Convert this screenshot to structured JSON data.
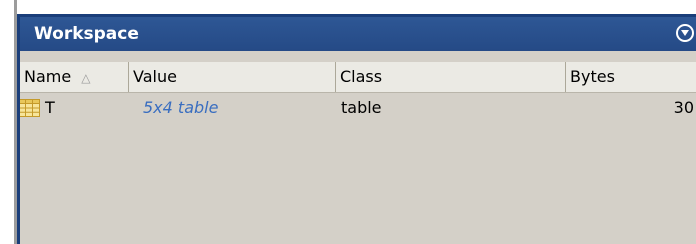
{
  "panel": {
    "title": "Workspace",
    "menu_icon": "chevron-down-circle-icon"
  },
  "columns": {
    "name": "Name",
    "value": "Value",
    "class": "Class",
    "bytes": "Bytes",
    "sort_indicator": "△"
  },
  "rows": [
    {
      "icon": "table-variable-icon",
      "name": "T",
      "value": "5x4 table",
      "class": "table",
      "bytes": "30"
    }
  ],
  "colors": {
    "title_bar": "#254a86",
    "panel_background": "#d4d0c8",
    "value_link": "#3a6ec0"
  }
}
